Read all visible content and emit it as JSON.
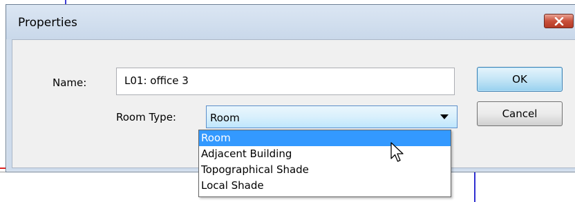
{
  "dialog": {
    "title": "Properties",
    "close_icon": "close-icon"
  },
  "form": {
    "name_label": "Name:",
    "name_value": "L01: office 3",
    "room_type_label": "Room Type:",
    "room_type_value": "Room"
  },
  "buttons": {
    "ok_label": "OK",
    "cancel_label": "Cancel"
  },
  "dropdown": {
    "selected_index": 0,
    "options": [
      "Room",
      "Adjacent Building",
      "Topographical Shade",
      "Local Shade"
    ]
  },
  "colors": {
    "selection": "#3399ff",
    "close_button": "#c9503b"
  }
}
